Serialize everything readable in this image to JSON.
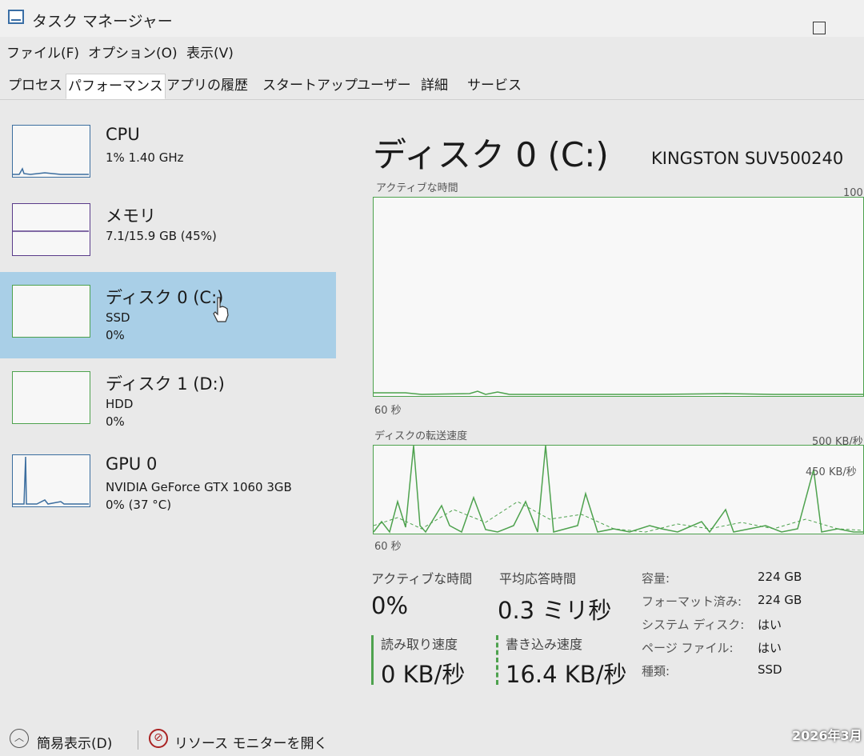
{
  "window": {
    "title": "タスク マネージャー"
  },
  "menu": [
    "ファイル(F)",
    "オプション(O)",
    "表示(V)"
  ],
  "tabs": [
    {
      "label": "プロセス",
      "active": false
    },
    {
      "label": "パフォーマンス",
      "active": true
    },
    {
      "label": "アプリの履歴",
      "active": false
    },
    {
      "label": "スタートアップ",
      "active": false
    },
    {
      "label": "ユーザー",
      "active": false
    },
    {
      "label": "詳細",
      "active": false
    },
    {
      "label": "サービス",
      "active": false
    }
  ],
  "sidebar": {
    "items": [
      {
        "name": "CPU",
        "sub1": "1%  1.40 GHz",
        "sub2": ""
      },
      {
        "name": "メモリ",
        "sub1": "7.1/15.9 GB (45%)",
        "sub2": ""
      },
      {
        "name": "ディスク 0 (C:)",
        "sub1": "SSD",
        "sub2": "0%",
        "selected": true
      },
      {
        "name": "ディスク 1 (D:)",
        "sub1": "HDD",
        "sub2": "0%"
      },
      {
        "name": "GPU 0",
        "sub1": "NVIDIA GeForce GTX 1060 3GB",
        "sub2": "0% (37 °C)"
      }
    ]
  },
  "main": {
    "title": "ディスク 0 (C:)",
    "model": "KINGSTON SUV500240",
    "graph1": {
      "label": "アクティブな時間",
      "max": "100",
      "time": "60 秒"
    },
    "graph2": {
      "label": "ディスクの転送速度",
      "max": "500 KB/秒",
      "mid": "450 KB/秒",
      "time": "60 秒"
    },
    "stats": {
      "active_label": "アクティブな時間",
      "active_value": "0%",
      "resp_label": "平均応答時間",
      "resp_value": "0.3 ミリ秒",
      "read_label": "読み取り速度",
      "read_value": "0 KB/秒",
      "write_label": "書き込み速度",
      "write_value": "16.4 KB/秒"
    },
    "props": [
      {
        "label": "容量:",
        "value": "224 GB"
      },
      {
        "label": "フォーマット済み:",
        "value": "224 GB"
      },
      {
        "label": "システム ディスク:",
        "value": "はい"
      },
      {
        "label": "ページ ファイル:",
        "value": "はい"
      },
      {
        "label": "種類:",
        "value": "SSD"
      }
    ]
  },
  "footer": {
    "collapse": "簡易表示(D)",
    "resmon": "リソース モニターを開く"
  },
  "overlay": {
    "date_stamp": "2026年3月"
  },
  "colors": {
    "selected_bg": "#a9cfe7",
    "disk_green": "#4ea24e",
    "cpu_blue": "#3c6e9f"
  },
  "icons": [
    "task-manager-icon",
    "maximize-icon",
    "collapse-chevron-icon",
    "resource-monitor-icon",
    "hand-cursor-icon"
  ]
}
